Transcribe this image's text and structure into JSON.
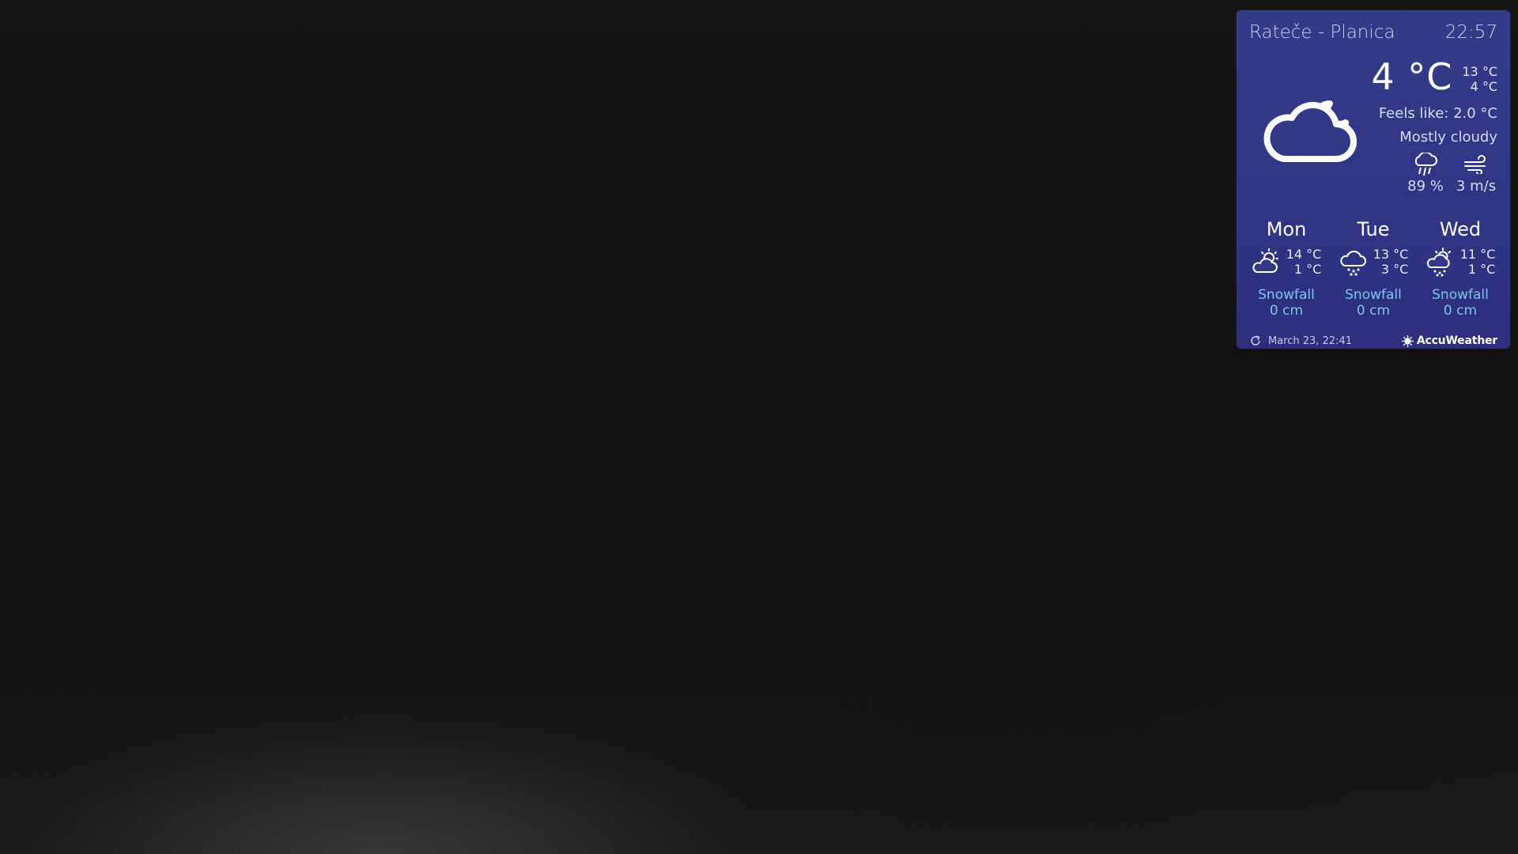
{
  "widget": {
    "location": "Rateče - Planica",
    "time": "22:57",
    "current": {
      "temp": "4 °C",
      "high": "13 °C",
      "low": "4 °C",
      "feels_like": "Feels like: 2.0 °C",
      "condition": "Mostly cloudy",
      "icon": "cloud-moon-icon",
      "precipitation": "89 %",
      "wind": "3 m/s"
    },
    "forecast": [
      {
        "day": "Mon",
        "high": "14 °C",
        "low": "1 °C",
        "icon": "partly-cloudy-sun-icon",
        "snow_label": "Snowfall",
        "snow_value": "0 cm"
      },
      {
        "day": "Tue",
        "high": "13 °C",
        "low": "3 °C",
        "icon": "cloud-snow-icon",
        "snow_label": "Snowfall",
        "snow_value": "0 cm"
      },
      {
        "day": "Wed",
        "high": "11 °C",
        "low": "1 °C",
        "icon": "sun-cloud-snow-icon",
        "snow_label": "Snowfall",
        "snow_value": "0 cm"
      }
    ],
    "updated": "March 23, 22:41",
    "provider": "AccuWeather"
  },
  "colors": {
    "widget_bg": "#323a88",
    "accent_snow": "#7fc3e6"
  }
}
